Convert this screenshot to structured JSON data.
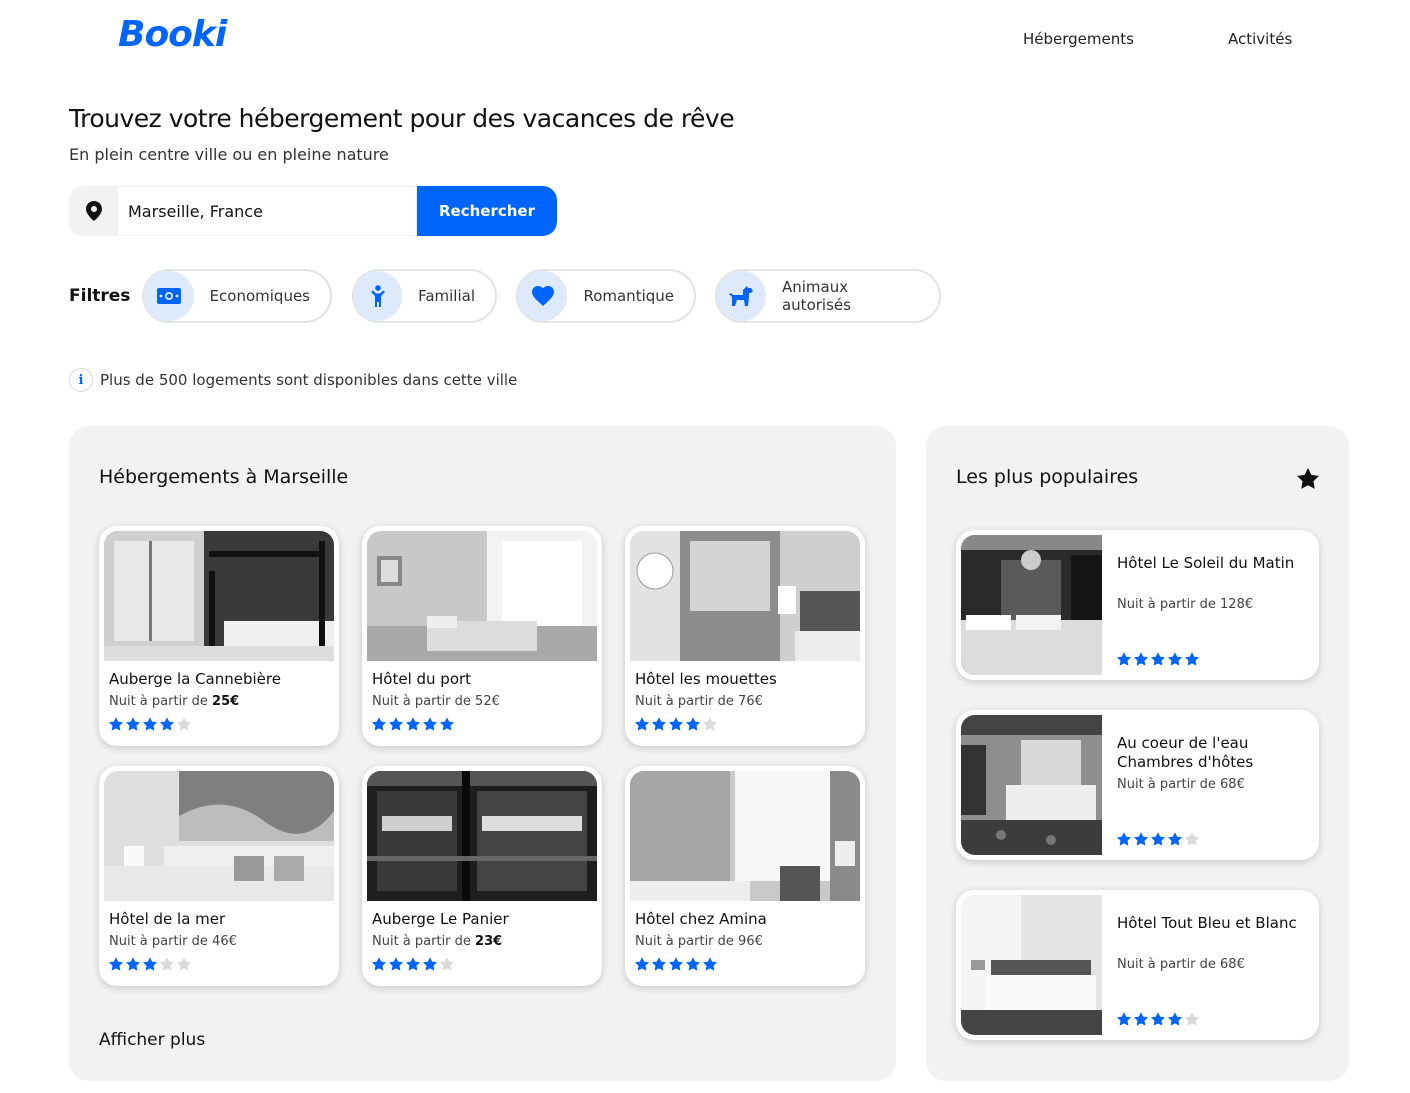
{
  "header": {
    "logo": "Booki",
    "nav": [
      "Hébergements",
      "Activités"
    ]
  },
  "hero": {
    "title": "Trouvez votre hébergement pour des vacances de rêve",
    "subtitle": "En plein centre ville ou en pleine nature"
  },
  "search": {
    "value": "Marseille, France",
    "button_label": "Rechercher"
  },
  "filters": {
    "label": "Filtres",
    "items": [
      {
        "label": "Economiques",
        "icon": "money-icon"
      },
      {
        "label": "Familial",
        "icon": "child-icon"
      },
      {
        "label": "Romantique",
        "icon": "heart-icon"
      },
      {
        "label": "Animaux autorisés",
        "icon": "dog-icon"
      }
    ]
  },
  "info": {
    "text": "Plus de 500 logements sont disponibles dans cette ville"
  },
  "lodgings": {
    "title": "Hébergements à Marseille",
    "price_prefix": "Nuit à partir de ",
    "items": [
      {
        "name": "Auberge la Cannebière",
        "price": "25€",
        "price_bold": true,
        "rating": 4
      },
      {
        "name": "Hôtel du port",
        "price": "52€",
        "price_bold": false,
        "rating": 5
      },
      {
        "name": "Hôtel les mouettes",
        "price": "76€",
        "price_bold": false,
        "rating": 4
      },
      {
        "name": "Hôtel de la mer",
        "price": "46€",
        "price_bold": false,
        "rating": 3
      },
      {
        "name": "Auberge Le Panier",
        "price": "23€",
        "price_bold": true,
        "rating": 4
      },
      {
        "name": "Hôtel chez Amina",
        "price": "96€",
        "price_bold": false,
        "rating": 5
      }
    ],
    "show_more": "Afficher plus"
  },
  "popular": {
    "title": "Les plus populaires",
    "items": [
      {
        "name": "Hôtel Le Soleil du Matin",
        "price": "Nuit à partir de 128€",
        "rating": 5
      },
      {
        "name": "Au coeur de l'eau Chambres d'hôtes",
        "price": "Nuit à partir de 68€",
        "rating": 4
      },
      {
        "name": "Hôtel Tout Bleu et Blanc",
        "price": "Nuit à partir de 68€",
        "rating": 4
      }
    ]
  },
  "colors": {
    "accent": "#0065fc",
    "accent_light": "#dee9fb",
    "panel_bg": "#f2f2f2",
    "star_off": "#d9d9d9"
  }
}
